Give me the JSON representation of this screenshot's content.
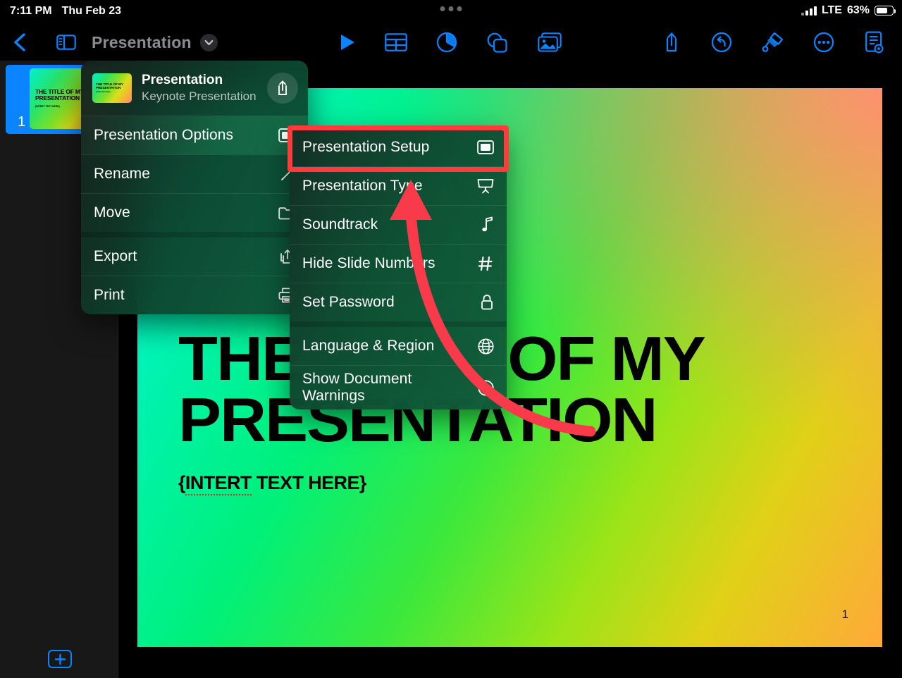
{
  "status_bar": {
    "time": "7:11 PM",
    "date": "Thu Feb 23",
    "network": "LTE",
    "battery_percent": "63%",
    "signal_icon": "cellular-bars-icon",
    "battery_icon": "battery-icon"
  },
  "toolbar": {
    "back_icon": "chevron-left-icon",
    "sidebar_icon": "sidebar-toggle-icon",
    "title": "Presentation",
    "title_chevron_icon": "chevron-down-icon",
    "play_icon": "play-icon",
    "table_icon": "table-icon",
    "chart_icon": "pie-chart-icon",
    "shape_icon": "shapes-icon",
    "media_icon": "media-image-icon",
    "share_icon": "share-icon",
    "undo_icon": "undo-icon",
    "format_icon": "paintbrush-icon",
    "more_icon": "ellipsis-circle-icon",
    "navigator_icon": "document-navigator-icon",
    "accent_color": "#0a84ff"
  },
  "sidebar": {
    "selected_slide_number": "1",
    "thumbnail_title": "THE TITLE OF MY PRESENTATION",
    "thumbnail_subtitle": "{INTERT TEXT HERE}",
    "add_slide_icon": "plus-icon",
    "selection_color": "#0a84ff"
  },
  "slide": {
    "title": "THE TITLE OF MY PRESENTATION",
    "subtitle_misspelled": "INTERT",
    "subtitle_rest": " TEXT HERE}",
    "subtitle_open": "{",
    "page_number": "1"
  },
  "context_menu": {
    "header": {
      "name": "Presentation",
      "subtitle": "Keynote Presentation...",
      "thumb_title": "THE TITLE OF MY PRESENTATION",
      "thumb_sub": "{INTERT TEXT HERE}",
      "share_icon": "share-icon"
    },
    "items": [
      {
        "label": "Presentation Options",
        "icon": "presentation-display-icon",
        "selected": true
      },
      {
        "label": "Rename",
        "icon": "pencil-icon",
        "selected": false
      },
      {
        "label": "Move",
        "icon": "folder-icon",
        "selected": false
      },
      {
        "label": "Export",
        "icon": "export-icon",
        "selected": false
      },
      {
        "label": "Print",
        "icon": "printer-icon",
        "selected": false
      }
    ]
  },
  "submenu": {
    "items": [
      {
        "label": "Presentation Setup",
        "icon": "presentation-display-icon"
      },
      {
        "label": "Presentation Type",
        "icon": "projector-screen-icon"
      },
      {
        "label": "Soundtrack",
        "icon": "music-note-icon"
      },
      {
        "label": "Hide Slide Numbers",
        "icon": "number-sign-icon"
      },
      {
        "label": "Set Password",
        "icon": "lock-icon"
      },
      {
        "label": "Language & Region",
        "icon": "globe-icon"
      },
      {
        "label": "Show Document Warnings",
        "icon": "warning-circle-icon"
      }
    ]
  },
  "annotation": {
    "highlight_color": "#ff3b3b",
    "arrow_color": "#f83a4b",
    "highlight_target": "Presentation Setup"
  }
}
